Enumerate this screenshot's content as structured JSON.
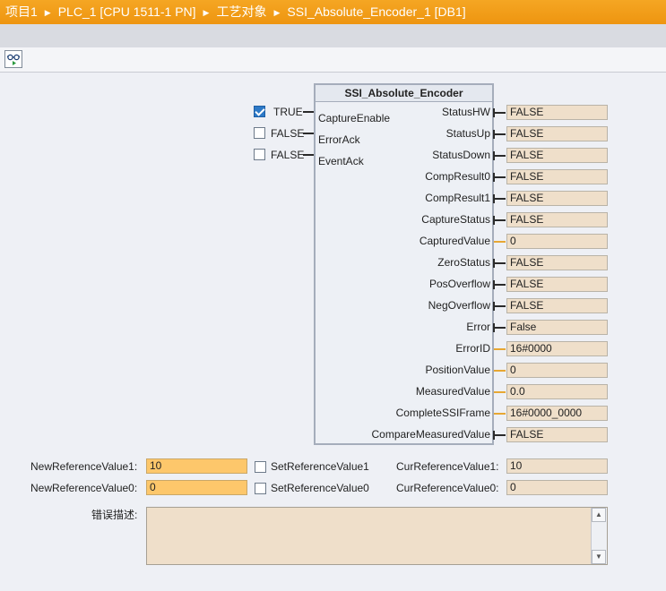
{
  "breadcrumb": [
    "项目1",
    "PLC_1 [CPU 1511-1 PN]",
    "工艺对象",
    "SSI_Absolute_Encoder_1 [DB1]"
  ],
  "icons": {
    "separator": "triangle-right-icon",
    "toolbar": "glasses-monitor-icon",
    "scroll_up": "chevron-up-icon",
    "scroll_down": "chevron-down-icon"
  },
  "colors": {
    "accent": "#f09a12",
    "field_bg": "#efdfca",
    "edit_bg": "#fdc76b",
    "num_wire": "#e7a733"
  },
  "block": {
    "name": "SSI_Absolute_Encoder",
    "inputs": [
      {
        "pin": "CaptureEnable",
        "value": "TRUE",
        "checked": true
      },
      {
        "pin": "ErrorAck",
        "value": "FALSE",
        "checked": false
      },
      {
        "pin": "EventAck",
        "value": "FALSE",
        "checked": false
      }
    ],
    "outputs": [
      {
        "pin": "StatusHW",
        "value": "FALSE",
        "type": "bool"
      },
      {
        "pin": "StatusUp",
        "value": "FALSE",
        "type": "bool"
      },
      {
        "pin": "StatusDown",
        "value": "FALSE",
        "type": "bool"
      },
      {
        "pin": "CompResult0",
        "value": "FALSE",
        "type": "bool"
      },
      {
        "pin": "CompResult1",
        "value": "FALSE",
        "type": "bool"
      },
      {
        "pin": "CaptureStatus",
        "value": "FALSE",
        "type": "bool"
      },
      {
        "pin": "CapturedValue",
        "value": "0",
        "type": "num"
      },
      {
        "pin": "ZeroStatus",
        "value": "FALSE",
        "type": "bool"
      },
      {
        "pin": "PosOverflow",
        "value": "FALSE",
        "type": "bool"
      },
      {
        "pin": "NegOverflow",
        "value": "FALSE",
        "type": "bool"
      },
      {
        "pin": "Error",
        "value": "False",
        "type": "bool"
      },
      {
        "pin": "ErrorID",
        "value": "16#0000",
        "type": "num"
      },
      {
        "pin": "PositionValue",
        "value": "0",
        "type": "num"
      },
      {
        "pin": "MeasuredValue",
        "value": "0.0",
        "type": "num"
      },
      {
        "pin": "CompleteSSIFrame",
        "value": "16#0000_0000",
        "type": "num"
      },
      {
        "pin": "CompareMeasuredValue",
        "value": "FALSE",
        "type": "bool"
      }
    ]
  },
  "reference": [
    {
      "new_label": "NewReferenceValue1:",
      "new_value": "10",
      "set_label": "SetReferenceValue1",
      "cur_label": "CurReferenceValue1:",
      "cur_value": "10"
    },
    {
      "new_label": "NewReferenceValue0:",
      "new_value": "0",
      "set_label": "SetReferenceValue0",
      "cur_label": "CurReferenceValue0:",
      "cur_value": "0"
    }
  ],
  "error_description": {
    "label": "错误描述:",
    "value": ""
  }
}
